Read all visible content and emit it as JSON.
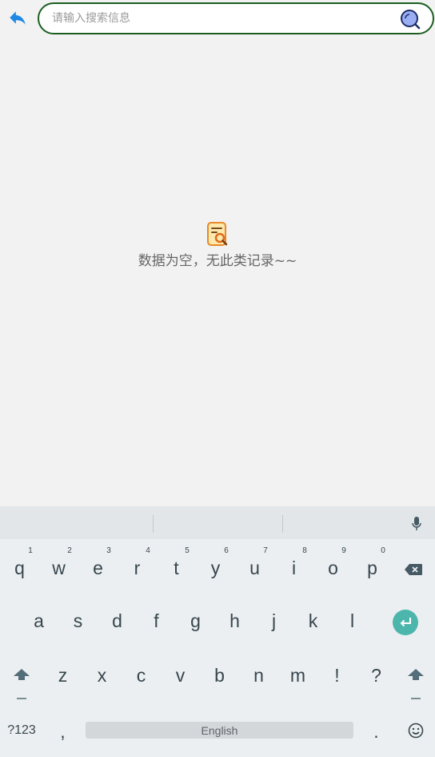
{
  "header": {
    "back_icon": "back-arrow-icon",
    "search_placeholder": "请输入搜索信息",
    "search_icon": "search-icon"
  },
  "empty_state": {
    "icon": "document-search-icon",
    "message": "数据为空，无此类记录~~"
  },
  "keyboard": {
    "mic_icon": "microphone-icon",
    "row1": [
      {
        "key": "q",
        "hint": "1"
      },
      {
        "key": "w",
        "hint": "2"
      },
      {
        "key": "e",
        "hint": "3"
      },
      {
        "key": "r",
        "hint": "4"
      },
      {
        "key": "t",
        "hint": "5"
      },
      {
        "key": "y",
        "hint": "6"
      },
      {
        "key": "u",
        "hint": "7"
      },
      {
        "key": "i",
        "hint": "8"
      },
      {
        "key": "o",
        "hint": "9"
      },
      {
        "key": "p",
        "hint": "0"
      }
    ],
    "backspace_icon": "backspace-icon",
    "row2": [
      "a",
      "s",
      "d",
      "f",
      "g",
      "h",
      "j",
      "k",
      "l"
    ],
    "enter_icon": "enter-icon",
    "shift_icon": "shift-icon",
    "row3": [
      "z",
      "x",
      "c",
      "v",
      "b",
      "n",
      "m",
      "!",
      "?"
    ],
    "row4": {
      "symbols_label": "?123",
      "comma": ",",
      "space_label": "English",
      "period": ".",
      "emoji_icon": "emoji-icon"
    }
  },
  "colors": {
    "back_arrow": "#1e88e5",
    "search_border": "#1b5e20",
    "enter_key": "#4db6ac",
    "empty_text": "#666666",
    "key_text": "#37474f"
  }
}
